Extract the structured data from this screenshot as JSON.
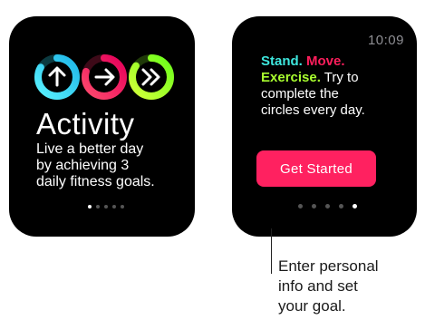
{
  "screen_left": {
    "title": "Activity",
    "tagline_lines": [
      "Live a better day",
      "by achieving 3",
      "daily fitness goals."
    ],
    "rings": [
      {
        "icon": "arrow-up-icon",
        "color": "#32d1e6"
      },
      {
        "icon": "arrow-right-icon",
        "color": "#ff1e5c"
      },
      {
        "icon": "double-chevron-right-icon",
        "color": "#a9ff2f"
      }
    ],
    "page_indicator": {
      "count": 5,
      "active_index": 0
    }
  },
  "screen_right": {
    "time": "10:09",
    "intro": {
      "stand": "Stand.",
      "move": "Move.",
      "exercise": "Exercise.",
      "line2_rest": " Try to",
      "line3": "complete the",
      "line4": "circles every day."
    },
    "button_label": "Get Started",
    "page_indicator": {
      "count": 5,
      "active_index": 4
    }
  },
  "callout": {
    "lines": [
      "Enter personal",
      "info and set",
      "your goal."
    ]
  },
  "colors": {
    "stand": "#3ee7de",
    "move": "#ff1e5c",
    "exercise": "#a9ff2f",
    "button": "#ff2160"
  }
}
